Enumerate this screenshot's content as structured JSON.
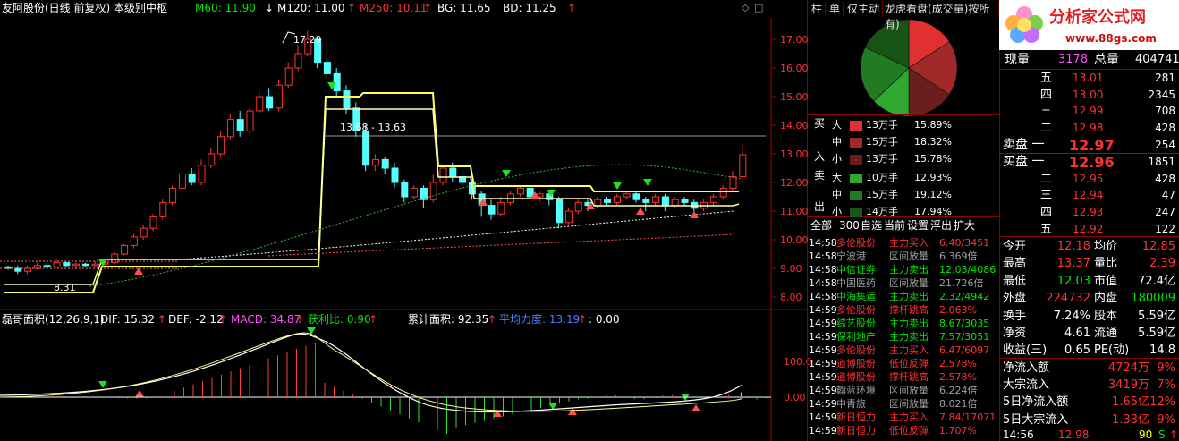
{
  "header": {
    "title": "友阿股份(日线 前复权) 本级别中枢",
    "m60": "M60: 11.90",
    "m60_arrow": "↓",
    "m120": "M120: 11.00",
    "m120_arrow": "↑",
    "m250": "M250: 10.11",
    "m250_arrow": "↑",
    "bg": "BG: 11.65",
    "bd": "BD: 11.25",
    "bd_arrow": "↑"
  },
  "price_axis": [
    "17.00",
    "16.00",
    "15.00",
    "14.00",
    "13.00",
    "12.00",
    "11.00",
    "10.00",
    "9.00",
    "8.00"
  ],
  "annotations": {
    "high": "17.29",
    "low": "8.31",
    "range": "13.68 - 13.63"
  },
  "indicator": {
    "name": "磊哥面积(12,26,9,1)",
    "dif": "DIF: 15.32",
    "dif_arrow": "↑",
    "dea": "DEF: -2.12",
    "dea_arrow": "↑",
    "macd": "MACD: 34.87",
    "macd_arrow": "↑",
    "profit": "获利比: 0.90",
    "profit_arrow": "↑",
    "cum": "累计面积: 92.35",
    "cum_arrow": "↑",
    "avg": "平均力度: 13.19",
    "avg_arrow": "↑",
    "tail": ": 0.00",
    "axis": [
      "100.0",
      "0.00"
    ]
  },
  "tabs": [
    "柱",
    "单",
    "仅主动",
    "龙虎看盘(成交量)按所有)"
  ],
  "tabs_full": [
    "柱",
    "单",
    "仅主动",
    "龙虎看盘(成交量/按所有)"
  ],
  "pie": {
    "slices": [
      {
        "value": 15.89,
        "color": "#e03030"
      },
      {
        "value": 18.32,
        "color": "#a02a2a"
      },
      {
        "value": 15.78,
        "color": "#6a1e1e"
      },
      {
        "value": 12.93,
        "color": "#2fa82f"
      },
      {
        "value": 19.12,
        "color": "#227a22"
      },
      {
        "value": 17.94,
        "color": "#185418"
      }
    ]
  },
  "buy_sell": {
    "side_labels": [
      "买",
      "入",
      "卖",
      "出"
    ],
    "rows": [
      {
        "size": "大",
        "vol": "13万手",
        "pct": "15.89%",
        "color": "#e03030"
      },
      {
        "size": "中",
        "vol": "15万手",
        "pct": "18.32%",
        "color": "#a02a2a"
      },
      {
        "size": "小",
        "vol": "13万手",
        "pct": "15.78%",
        "color": "#6a1e1e"
      },
      {
        "size": "大",
        "vol": "10万手",
        "pct": "12.93%",
        "color": "#2fa82f"
      },
      {
        "size": "中",
        "vol": "15万手",
        "pct": "19.12%",
        "color": "#227a22"
      },
      {
        "size": "小",
        "vol": "14万手",
        "pct": "17.94%",
        "color": "#185418"
      }
    ]
  },
  "filter_bar": [
    "全部",
    "300",
    "自选",
    "当前",
    "设置",
    "浮出",
    "扩大"
  ],
  "ticks": [
    {
      "time": "14:58",
      "name": "多伦股份",
      "type": "主力买入",
      "val": "6.40/3451",
      "c": "red"
    },
    {
      "time": "14:58",
      "name": "宁波港",
      "type": "区间放量",
      "val": "6.369倍",
      "c": "gry"
    },
    {
      "time": "14:58",
      "name": "中信证券",
      "type": "主力卖出",
      "val": "12.03/4086",
      "c": "grn"
    },
    {
      "time": "14:58",
      "name": "中国医药",
      "type": "区间放量",
      "val": "21.726倍",
      "c": "gry"
    },
    {
      "time": "14:58",
      "name": "中海集运",
      "type": "主力卖出",
      "val": "2.32/4942",
      "c": "grn"
    },
    {
      "time": "14:59",
      "name": "多伦股份",
      "type": "撑杆跳高",
      "val": "2.063%",
      "c": "red"
    },
    {
      "time": "14:59",
      "name": "综艺股份",
      "type": "主力卖出",
      "val": "8.67/3035",
      "c": "grn"
    },
    {
      "time": "14:59",
      "name": "保利地产",
      "type": "主力卖出",
      "val": "7.57/3051",
      "c": "grn"
    },
    {
      "time": "14:59",
      "name": "多伦股份",
      "type": "主力买入",
      "val": "6.47/6097",
      "c": "red"
    },
    {
      "time": "14:59",
      "name": "道博股份",
      "type": "低位反弹",
      "val": "2.578%",
      "c": "red"
    },
    {
      "time": "14:59",
      "name": "道博股份",
      "type": "撑杆跳高",
      "val": "2.578%",
      "c": "red"
    },
    {
      "time": "14:59",
      "name": "翰蓝环境",
      "type": "区间放量",
      "val": "6.224倍",
      "c": "gry"
    },
    {
      "time": "14:59",
      "name": "中青旅",
      "type": "区间放量",
      "val": "8.021倍",
      "c": "gry"
    },
    {
      "time": "14:59",
      "name": "新日恒力",
      "type": "主力买入",
      "val": "7.84/17071",
      "c": "red"
    },
    {
      "time": "14:59",
      "name": "新日恒力",
      "type": "低位反弹",
      "val": "1.707%",
      "c": "red"
    }
  ],
  "logo": {
    "title": "分析家公式网",
    "url": "www.88gs.com"
  },
  "quote": {
    "xianliang_label": "现量",
    "xianliang": "3178",
    "zongliang_label": "总量",
    "zongliang": "404741",
    "asks": [
      {
        "label": "五",
        "price": "13.01",
        "vol": "281"
      },
      {
        "label": "四",
        "price": "13.00",
        "vol": "2345"
      },
      {
        "label": "三",
        "price": "12.99",
        "vol": "708"
      },
      {
        "label": "二",
        "price": "12.98",
        "vol": "428"
      },
      {
        "label": "卖盘 一",
        "price": "12.97",
        "vol": "254"
      }
    ],
    "bids": [
      {
        "label": "买盘 一",
        "price": "12.96",
        "vol": "1851"
      },
      {
        "label": "二",
        "price": "12.95",
        "vol": "428"
      },
      {
        "label": "三",
        "price": "12.94",
        "vol": "47"
      },
      {
        "label": "四",
        "price": "12.93",
        "vol": "247"
      },
      {
        "label": "五",
        "price": "12.92",
        "vol": "122"
      }
    ],
    "stats": [
      {
        "l1": "今开",
        "v1": "12.18",
        "c1": "red",
        "l2": "均价",
        "v2": "12.85",
        "c2": "red"
      },
      {
        "l1": "最高",
        "v1": "13.37",
        "c1": "red",
        "l2": "量比",
        "v2": "2.39",
        "c2": "red"
      },
      {
        "l1": "最低",
        "v1": "12.03",
        "c1": "grn",
        "l2": "市值",
        "v2": "72.4亿",
        "c2": "wht"
      },
      {
        "l1": "外盘",
        "v1": "224732",
        "c1": "red",
        "l2": "内盘",
        "v2": "180009",
        "c2": "grn"
      },
      {
        "l1": "换手",
        "v1": "7.24%",
        "c1": "wht",
        "l2": "股本",
        "v2": "5.59亿",
        "c2": "wht"
      },
      {
        "l1": "净资",
        "v1": "4.61",
        "c1": "wht",
        "l2": "流通",
        "v2": "5.59亿",
        "c2": "wht"
      },
      {
        "l1": "收益(三)",
        "v1": "0.65",
        "c1": "wht",
        "l2": "PE(动)",
        "v2": "14.8",
        "c2": "wht"
      }
    ],
    "flows": [
      {
        "label": "净流入额",
        "val": "4724万",
        "pct": "9%"
      },
      {
        "label": "大宗流入",
        "val": "3419万",
        "pct": "7%"
      },
      {
        "label": "5日净流入额",
        "val": "1.65亿",
        "pct": "12%"
      },
      {
        "label": "5日大宗流入",
        "val": "1.33亿",
        "pct": "9%"
      }
    ],
    "footer": {
      "time": "14:56",
      "price": "12.98",
      "vol": "90",
      "bs": "S"
    }
  }
}
